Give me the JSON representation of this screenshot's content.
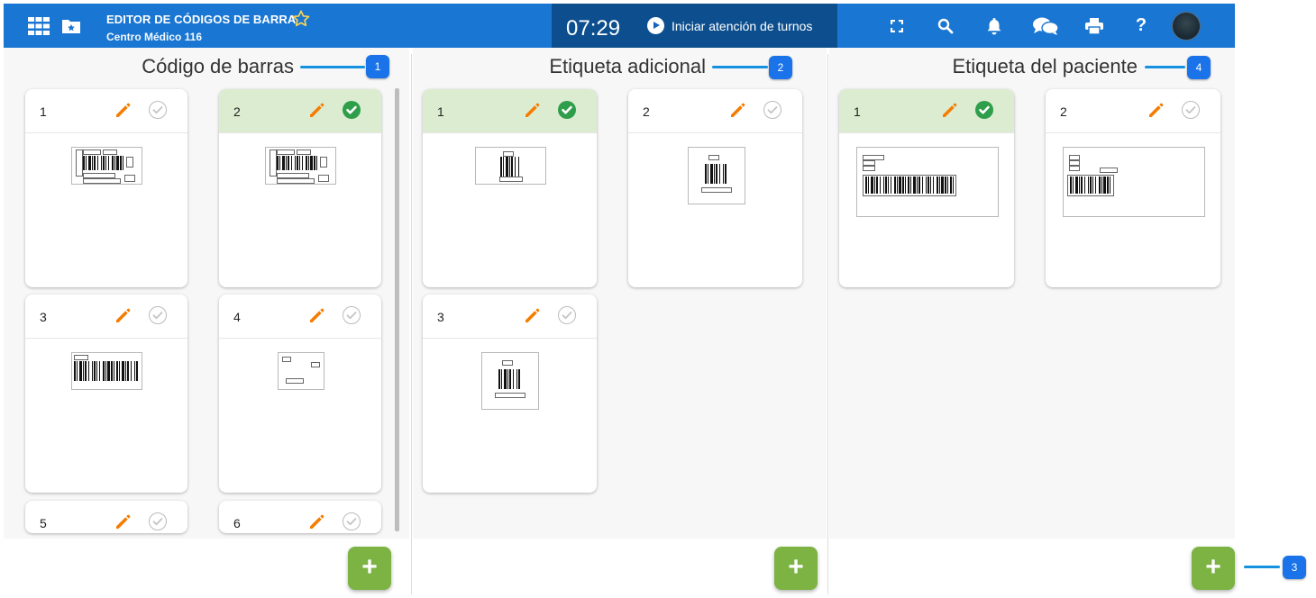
{
  "header": {
    "title": "EDITOR DE CÓDIGOS DE BARRA",
    "subtitle": "Centro Médico 116",
    "clock": "07:29",
    "start_button": "Iniciar atención de turnos",
    "icons": [
      "apps-grid-icon",
      "folder-star-icon",
      "favorite-star-icon",
      "fullscreen-icon",
      "search-icon",
      "notifications-bell-icon",
      "chat-icon",
      "print-icon",
      "help-icon",
      "user-avatar"
    ]
  },
  "panels": [
    {
      "title": "Código de barras",
      "callout": "1",
      "cards": [
        {
          "num": "1",
          "selected": false
        },
        {
          "num": "2",
          "selected": true
        },
        {
          "num": "3",
          "selected": false
        },
        {
          "num": "4",
          "selected": false
        },
        {
          "num": "5",
          "selected": false
        },
        {
          "num": "6",
          "selected": false
        }
      ]
    },
    {
      "title": "Etiqueta adicional",
      "callout": "2",
      "cards": [
        {
          "num": "1",
          "selected": true
        },
        {
          "num": "2",
          "selected": false
        },
        {
          "num": "3",
          "selected": false
        }
      ]
    },
    {
      "title": "Etiqueta del paciente",
      "callout": "4",
      "cards": [
        {
          "num": "1",
          "selected": true
        },
        {
          "num": "2",
          "selected": false
        }
      ]
    }
  ],
  "fab_label": "+",
  "add_callout": "3",
  "colors": {
    "header": "#1976d2",
    "clock_bg": "#0d4f8e",
    "selected": "#dcecd0",
    "edit": "#f57c00",
    "check_on": "#2e9e4a",
    "fab": "#7cb342",
    "callout": "#1a73e8"
  }
}
